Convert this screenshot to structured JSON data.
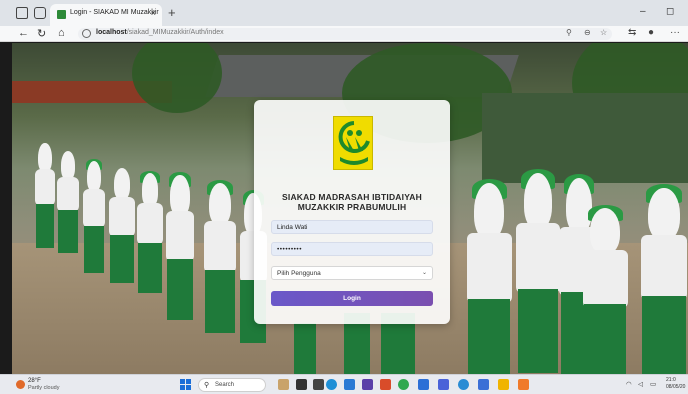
{
  "browser": {
    "tab_title": "Login - SIAKAD MI Muzakkir",
    "tab_close": "×",
    "new_tab": "+",
    "url_host": "localhost",
    "url_path": "/siakad_MIMuzakkir/Auth/index",
    "window_controls": [
      "–",
      "◻"
    ]
  },
  "login": {
    "title_line1": "SIAKAD MADRASAH IBTIDAIYAH",
    "title_line2": "MUZAKKIR PRABUMULIH",
    "username_value": "Linda Wati",
    "password_value": "•••••••••",
    "role_select_value": "Pilih Pengguna",
    "login_button": "Login"
  },
  "taskbar": {
    "weather_temp": "28°F",
    "weather_desc": "Partly cloudy",
    "search_placeholder": "Search",
    "clock_time": "21:0",
    "clock_date": "08/05/20"
  },
  "colors": {
    "accent_button": "#6a58c9",
    "logo_yellow": "#f0dc00",
    "logo_green": "#1f8a2a"
  }
}
